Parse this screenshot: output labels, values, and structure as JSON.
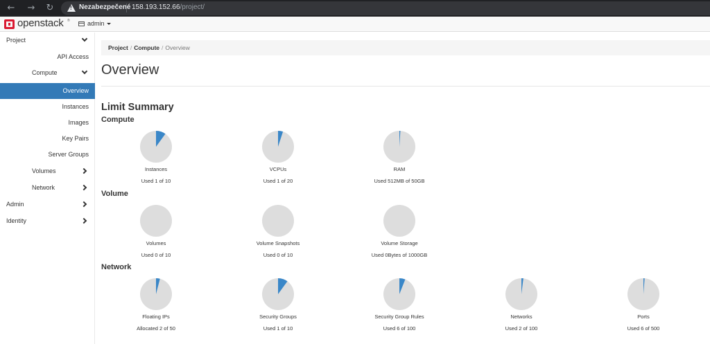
{
  "browser": {
    "security_label": "Nezabezpečené",
    "url_host": "158.193.152.66",
    "url_path": "/project/"
  },
  "topbar": {
    "logo": "openstack",
    "project": "admin"
  },
  "sidebar": {
    "items": [
      {
        "label": "Project",
        "level": 0,
        "chevron": "down"
      },
      {
        "label": "API Access",
        "level": 2
      },
      {
        "label": "Compute",
        "level": 1,
        "chevron": "down"
      },
      {
        "label": "Overview",
        "level": 2,
        "active": true
      },
      {
        "label": "Instances",
        "level": 2
      },
      {
        "label": "Images",
        "level": 2
      },
      {
        "label": "Key Pairs",
        "level": 2
      },
      {
        "label": "Server Groups",
        "level": 2
      },
      {
        "label": "Volumes",
        "level": 1,
        "chevron": "right"
      },
      {
        "label": "Network",
        "level": 1,
        "chevron": "right"
      },
      {
        "label": "Admin",
        "level": 0,
        "chevron": "right"
      },
      {
        "label": "Identity",
        "level": 0,
        "chevron": "right"
      }
    ]
  },
  "breadcrumb": {
    "project": "Project",
    "compute": "Compute",
    "current": "Overview",
    "separator": "/"
  },
  "page": {
    "title": "Overview",
    "limit_summary": "Limit Summary"
  },
  "colors": {
    "accent": "#337ab7",
    "pie_used": "#3a87c8",
    "pie_bg": "#dddddd"
  },
  "sections": [
    {
      "title": "Compute",
      "charts": [
        {
          "label": "Instances",
          "used_text": "Used 1 of 10",
          "used": 1,
          "total": 10
        },
        {
          "label": "VCPUs",
          "used_text": "Used 1 of 20",
          "used": 1,
          "total": 20
        },
        {
          "label": "RAM",
          "used_text": "Used 512MB of 50GB",
          "used": 512,
          "total": 51200
        }
      ]
    },
    {
      "title": "Volume",
      "charts": [
        {
          "label": "Volumes",
          "used_text": "Used 0 of 10",
          "used": 0,
          "total": 10
        },
        {
          "label": "Volume Snapshots",
          "used_text": "Used 0 of 10",
          "used": 0,
          "total": 10
        },
        {
          "label": "Volume Storage",
          "used_text": "Used 0Bytes of 1000GB",
          "used": 0,
          "total": 1000
        }
      ]
    },
    {
      "title": "Network",
      "charts": [
        {
          "label": "Floating IPs",
          "used_text": "Allocated 2 of 50",
          "used": 2,
          "total": 50
        },
        {
          "label": "Security Groups",
          "used_text": "Used 1 of 10",
          "used": 1,
          "total": 10
        },
        {
          "label": "Security Group Rules",
          "used_text": "Used 6 of 100",
          "used": 6,
          "total": 100
        },
        {
          "label": "Networks",
          "used_text": "Used 2 of 100",
          "used": 2,
          "total": 100
        },
        {
          "label": "Ports",
          "used_text": "Used 6 of 500",
          "used": 6,
          "total": 500
        }
      ]
    }
  ]
}
